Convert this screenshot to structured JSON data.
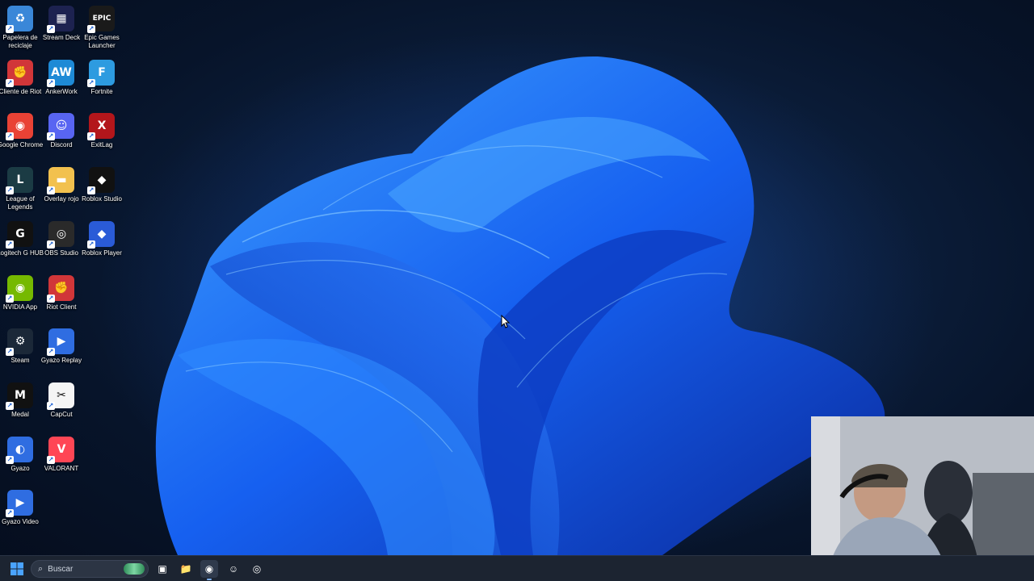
{
  "desktop": {
    "icons": [
      {
        "label": "Papelera de reciclaje",
        "icon": "recycle-bin-icon",
        "color": "#3a87d8",
        "symbol": "♻"
      },
      {
        "label": "Stream Deck",
        "icon": "stream-deck-icon",
        "color": "#1d2250",
        "symbol": "▦"
      },
      {
        "label": "Epic Games Launcher",
        "icon": "epic-games-icon",
        "color": "#1a1a1a",
        "symbol": "EPIC"
      },
      {
        "label": "Cliente de Riot",
        "icon": "riot-client-icon",
        "color": "#d13639",
        "symbol": "✊"
      },
      {
        "label": "AnkerWork",
        "icon": "ankerwork-icon",
        "color": "#1e8ad6",
        "symbol": "AW"
      },
      {
        "label": "Fortnite",
        "icon": "fortnite-icon",
        "color": "#2d9be0",
        "symbol": "F"
      },
      {
        "label": "Google Chrome",
        "icon": "chrome-icon",
        "color": "#e94235",
        "symbol": "◉"
      },
      {
        "label": "Discord",
        "icon": "discord-icon",
        "color": "#5865f2",
        "symbol": "☺"
      },
      {
        "label": "ExitLag",
        "icon": "exitlag-icon",
        "color": "#b3161b",
        "symbol": "X"
      },
      {
        "label": "League of Legends",
        "icon": "league-of-legends-icon",
        "color": "#1b3b44",
        "symbol": "L"
      },
      {
        "label": "Overlay rojo",
        "icon": "folder-icon",
        "color": "#f2c14e",
        "symbol": "▬"
      },
      {
        "label": "Roblox Studio",
        "icon": "roblox-studio-icon",
        "color": "#111111",
        "symbol": "◆"
      },
      {
        "label": "Logitech G HUB",
        "icon": "logitech-icon",
        "color": "#111111",
        "symbol": "G"
      },
      {
        "label": "OBS Studio",
        "icon": "obs-icon",
        "color": "#2a2a2a",
        "symbol": "◎"
      },
      {
        "label": "Roblox Player",
        "icon": "roblox-player-icon",
        "color": "#2a5bd7",
        "symbol": "◆"
      },
      {
        "label": "NVIDIA App",
        "icon": "nvidia-icon",
        "color": "#76b900",
        "symbol": "◉"
      },
      {
        "label": "Riot Client",
        "icon": "riot-client-icon",
        "color": "#d13639",
        "symbol": "✊"
      },
      {
        "label": "Steam",
        "icon": "steam-icon",
        "color": "#1b2838",
        "symbol": "⚙"
      },
      {
        "label": "Gyazo Replay",
        "icon": "gyazo-replay-icon",
        "color": "#2f6de1",
        "symbol": "▶"
      },
      {
        "label": "Medal",
        "icon": "medal-icon",
        "color": "#111111",
        "symbol": "M"
      },
      {
        "label": "CapCut",
        "icon": "capcut-icon",
        "color": "#f5f5f5",
        "symbol": "✂"
      },
      {
        "label": "Gyazo",
        "icon": "gyazo-icon",
        "color": "#2f6de1",
        "symbol": "◐"
      },
      {
        "label": "VALORANT",
        "icon": "valorant-icon",
        "color": "#ff4655",
        "symbol": "V"
      },
      {
        "label": "Gyazo Video",
        "icon": "gyazo-video-icon",
        "color": "#2f6de1",
        "symbol": "▶"
      }
    ]
  },
  "taskbar": {
    "search_placeholder": "Buscar",
    "pinned": [
      {
        "icon": "task-view-icon",
        "symbol": "▣"
      },
      {
        "icon": "file-explorer-icon",
        "symbol": "📁"
      },
      {
        "icon": "chrome-icon",
        "symbol": "◉",
        "active": true
      },
      {
        "icon": "discord-icon",
        "symbol": "☺"
      },
      {
        "icon": "obs-icon",
        "symbol": "◎"
      }
    ]
  },
  "colors": {
    "accent": "#1e6bff",
    "taskbar": "#1c2431"
  }
}
